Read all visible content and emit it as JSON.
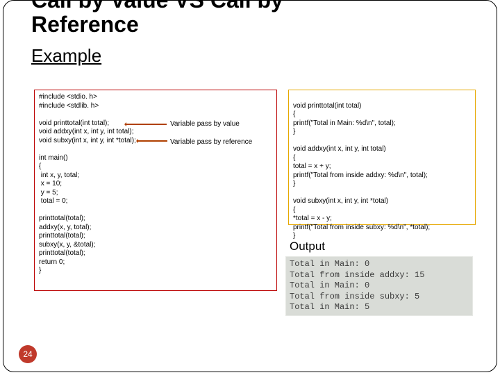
{
  "title": "Call by Value VS Call by\nReference",
  "subtitle": "Example",
  "annotations": {
    "byvalue": "Variable pass by value",
    "byref": "Variable pass by reference"
  },
  "code_left": "#include <stdio. h>\n#include <stdlib. h>\n\nvoid printtotal(int total);\nvoid addxy(int x, int y, int total);\nvoid subxy(int x, int y, int *total);\n\nint main()\n{\n int x, y, total;\n x = 10;\n y = 5;\n total = 0;\n\nprinttotal(total);\naddxy(x, y, total);\nprinttotal(total);\nsubxy(x, y, &total);\nprinttotal(total);\nreturn 0;\n}",
  "code_right": "\nvoid printtotal(int total)\n{\nprintf(\"Total in Main: %d\\n\", total);\n}\n\nvoid addxy(int x, int y, int total)\n{\ntotal = x + y;\nprintf(\"Total from inside addxy: %d\\n\", total);\n}\n\nvoid subxy(int x, int y, int *total)\n{\n*total = x - y;\nprintf(\"Total from inside subxy: %d\\n\", *total);\n}",
  "output_label": "Output",
  "output_text": "Total in Main: 0\nTotal from inside addxy: 15\nTotal in Main: 0\nTotal from inside subxy: 5\nTotal in Main: 5",
  "page_number": "24"
}
